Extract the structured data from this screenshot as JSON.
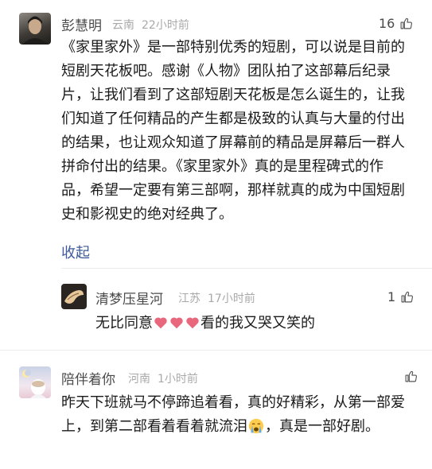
{
  "comments": [
    {
      "user": "彭慧明",
      "location": "云南",
      "time": "22小时前",
      "likes": "16",
      "text": "《家里家外》是一部特别优秀的短剧，可以说是目前的短剧天花板吧。感谢《人物》团队拍了这部幕后纪录片，让我们看到了这部短剧天花板是怎么诞生的，让我们知道了任何精品的产生都是极致的认真与大量的付出的结果，也让观众知道了屏幕前的精品是屏幕后一群人拼命付出的结果。《家里家外》真的是里程碑式的作品，希望一定要有第三部啊，那样就真的成为中国短剧史和影视史的绝对经典了。",
      "collapse_label": "收起",
      "reply": {
        "user": "清梦压星河",
        "location": "江苏",
        "time": "17小时前",
        "likes": "1",
        "text_before": "无比同意",
        "text_after": "看的我又哭又笑的"
      }
    },
    {
      "user": "陪伴着你",
      "location": "河南",
      "time": "1小时前",
      "likes": "",
      "text_before": "昨天下班就马不停蹄追着看，真的好精彩，从第一部爱上，到第二部看着看着就流泪",
      "text_after": "，真是一部好剧。"
    }
  ],
  "icons": {
    "like": "thumbs-up-icon",
    "heart": "heart-emoji-icon",
    "cry": "crying-face-emoji-icon"
  },
  "colors": {
    "link": "#3d5a9a",
    "meta": "#a9a9a9",
    "name": "#4a4a4a"
  }
}
